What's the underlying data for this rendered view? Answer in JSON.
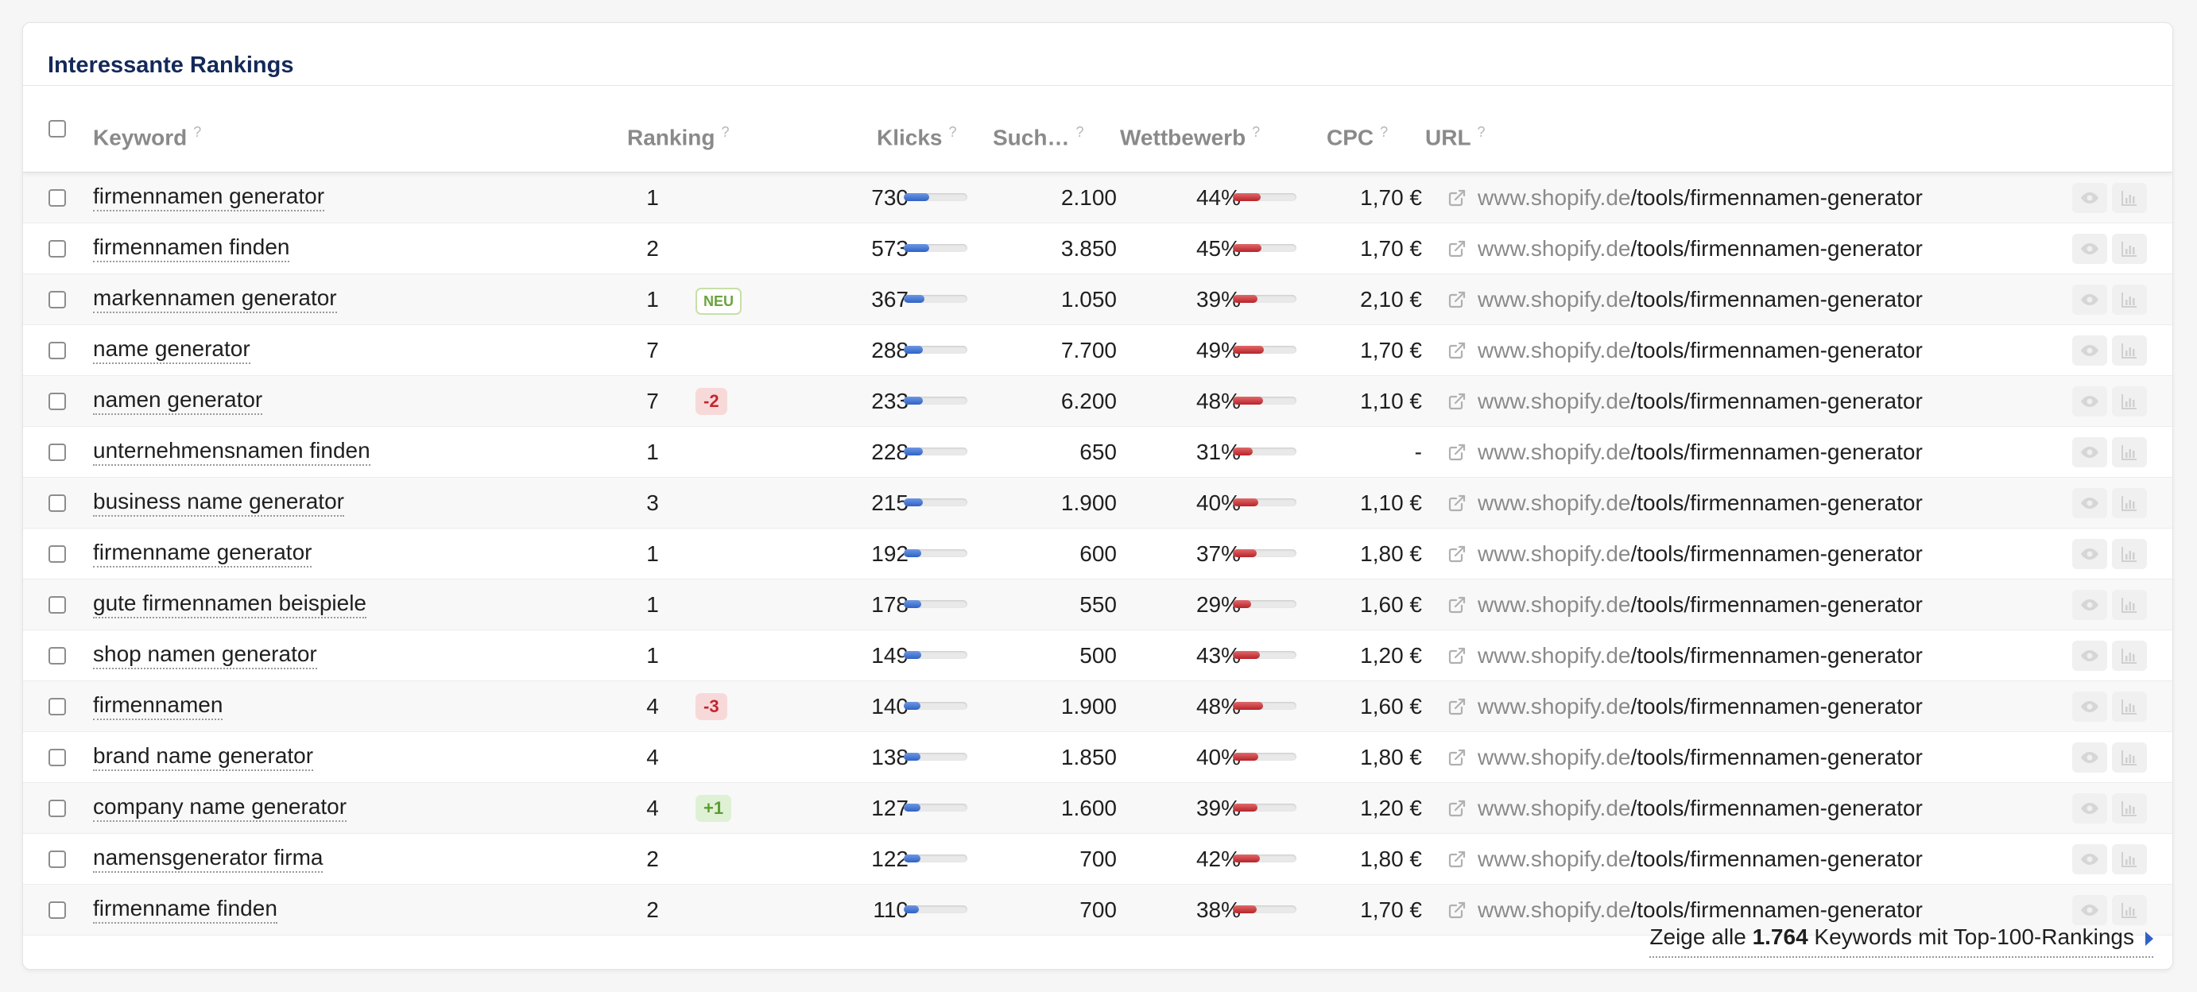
{
  "panel": {
    "title": "Interessante Rankings"
  },
  "header": {
    "keyword": "Keyword",
    "ranking": "Ranking",
    "klicks": "Klicks",
    "such": "Such…",
    "wettbewerb": "Wettbewerb",
    "cpc": "CPC",
    "url": "URL",
    "help": "?"
  },
  "url": {
    "domain": "www.shopify.de",
    "path": "/tools/firmennamen-generator"
  },
  "rows": [
    {
      "keyword": "firmennamen generator",
      "ranking": "1",
      "badge": "",
      "badge_type": "",
      "klicks": "730",
      "klicks_level": 0.4,
      "such": "2.100",
      "wett": "44%",
      "wett_level": 0.44,
      "cpc": "1,70 €"
    },
    {
      "keyword": "firmennamen finden",
      "ranking": "2",
      "badge": "",
      "badge_type": "",
      "klicks": "573",
      "klicks_level": 0.4,
      "such": "3.850",
      "wett": "45%",
      "wett_level": 0.45,
      "cpc": "1,70 €"
    },
    {
      "keyword": "markennamen generator",
      "ranking": "1",
      "badge": "NEU",
      "badge_type": "neu",
      "klicks": "367",
      "klicks_level": 0.32,
      "such": "1.050",
      "wett": "39%",
      "wett_level": 0.39,
      "cpc": "2,10 €"
    },
    {
      "keyword": "name generator",
      "ranking": "7",
      "badge": "",
      "badge_type": "",
      "klicks": "288",
      "klicks_level": 0.3,
      "such": "7.700",
      "wett": "49%",
      "wett_level": 0.49,
      "cpc": "1,70 €"
    },
    {
      "keyword": "namen generator",
      "ranking": "7",
      "badge": "-2",
      "badge_type": "down",
      "klicks": "233",
      "klicks_level": 0.3,
      "such": "6.200",
      "wett": "48%",
      "wett_level": 0.48,
      "cpc": "1,10 €"
    },
    {
      "keyword": "unternehmensnamen finden",
      "ranking": "1",
      "badge": "",
      "badge_type": "",
      "klicks": "228",
      "klicks_level": 0.3,
      "such": "650",
      "wett": "31%",
      "wett_level": 0.31,
      "cpc": "-"
    },
    {
      "keyword": "business name generator",
      "ranking": "3",
      "badge": "",
      "badge_type": "",
      "klicks": "215",
      "klicks_level": 0.3,
      "such": "1.900",
      "wett": "40%",
      "wett_level": 0.4,
      "cpc": "1,10 €"
    },
    {
      "keyword": "firmenname generator",
      "ranking": "1",
      "badge": "",
      "badge_type": "",
      "klicks": "192",
      "klicks_level": 0.28,
      "such": "600",
      "wett": "37%",
      "wett_level": 0.37,
      "cpc": "1,80 €"
    },
    {
      "keyword": "gute firmennamen beispiele",
      "ranking": "1",
      "badge": "",
      "badge_type": "",
      "klicks": "178",
      "klicks_level": 0.28,
      "such": "550",
      "wett": "29%",
      "wett_level": 0.29,
      "cpc": "1,60 €"
    },
    {
      "keyword": "shop namen generator",
      "ranking": "1",
      "badge": "",
      "badge_type": "",
      "klicks": "149",
      "klicks_level": 0.28,
      "such": "500",
      "wett": "43%",
      "wett_level": 0.43,
      "cpc": "1,20 €"
    },
    {
      "keyword": "firmennamen",
      "ranking": "4",
      "badge": "-3",
      "badge_type": "down",
      "klicks": "140",
      "klicks_level": 0.26,
      "such": "1.900",
      "wett": "48%",
      "wett_level": 0.48,
      "cpc": "1,60 €"
    },
    {
      "keyword": "brand name generator",
      "ranking": "4",
      "badge": "",
      "badge_type": "",
      "klicks": "138",
      "klicks_level": 0.26,
      "such": "1.850",
      "wett": "40%",
      "wett_level": 0.4,
      "cpc": "1,80 €"
    },
    {
      "keyword": "company name generator",
      "ranking": "4",
      "badge": "+1",
      "badge_type": "up",
      "klicks": "127",
      "klicks_level": 0.26,
      "such": "1.600",
      "wett": "39%",
      "wett_level": 0.39,
      "cpc": "1,20 €"
    },
    {
      "keyword": "namensgenerator firma",
      "ranking": "2",
      "badge": "",
      "badge_type": "",
      "klicks": "122",
      "klicks_level": 0.26,
      "such": "700",
      "wett": "42%",
      "wett_level": 0.42,
      "cpc": "1,80 €"
    },
    {
      "keyword": "firmenname finden",
      "ranking": "2",
      "badge": "",
      "badge_type": "",
      "klicks": "110",
      "klicks_level": 0.24,
      "such": "700",
      "wett": "38%",
      "wett_level": 0.38,
      "cpc": "1,70 €"
    }
  ],
  "footer": {
    "prefix": "Zeige alle ",
    "count": "1.764",
    "suffix": " Keywords mit Top-100-Rankings"
  },
  "colors": {
    "title": "#14295a",
    "blue_bar": "#2f62c6",
    "red_bar": "#b8222a"
  },
  "icons": {
    "url_link": "external-link-icon",
    "row_action_1": "eye-icon",
    "row_action_2": "bar-chart-icon",
    "footer_arrow": "caret-right-icon"
  }
}
